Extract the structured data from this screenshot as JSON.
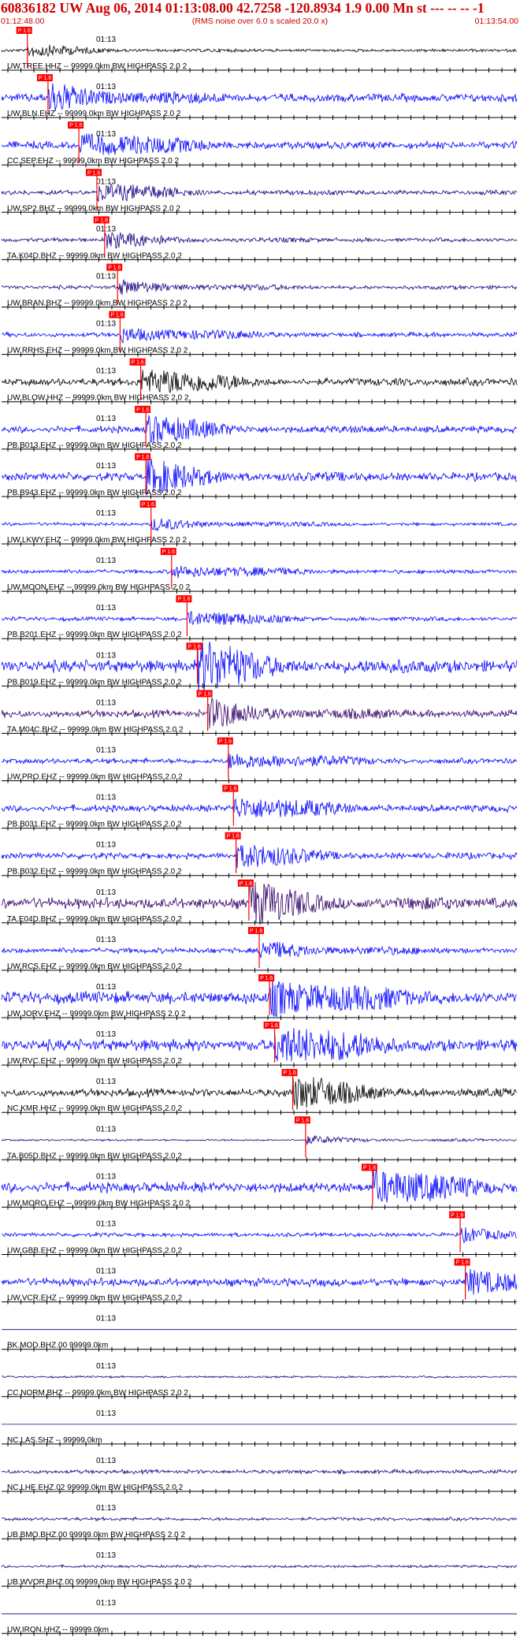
{
  "header": {
    "title": "60836182 UW Aug 06, 2014 01:13:08.00   42.7258 -120.8934  1.9 0.00 Mn st --- -- --   -1",
    "start_time": "01:12:48.00",
    "rms_note": "(RMS noise over 6.0 s scaled 20.0 x)",
    "end_time": "01:13:54.00"
  },
  "colors": {
    "header_text": "#cc0000",
    "pick_line": "#ff0000",
    "pick_box": "#ff0000",
    "axis": "#000000",
    "trace_blue": "#0000ff",
    "trace_indigo": "#1a0080",
    "trace_dark": "#330066",
    "trace_black": "#000000",
    "label_text": "#000000"
  },
  "minute_label": "01:13",
  "pick_label": "P 1.6",
  "channels": [
    {
      "label": "UW.TREE.HHZ -- 99999.0km BW  HIGHPASS  2.0  2",
      "color": "#000000",
      "level": 0.22,
      "pick": 0.05
    },
    {
      "label": "UW.BLN.EHZ -- 99999.0km BW  HIGHPASS  2.0  2",
      "color": "#0000ff",
      "level": 0.6,
      "pick": 0.09
    },
    {
      "label": "CC.SEP.EHZ -- 99999.0km BW  HIGHPASS  2.0  2",
      "color": "#0000ff",
      "level": 0.55,
      "pick": 0.15
    },
    {
      "label": "UW.SP2.BHZ -- 99999.0km BW  HIGHPASS  2.0  2",
      "color": "#1a0080",
      "level": 0.35,
      "pick": 0.185
    },
    {
      "label": "TA.K04D.BHZ -- 99999.0km BW  HIGHPASS  2.0  2",
      "color": "#1a0080",
      "level": 0.3,
      "pick": 0.2
    },
    {
      "label": "UW.BRAN.BHZ -- 99999.0km BW  HIGHPASS  2.0  2",
      "color": "#1a0080",
      "level": 0.3,
      "pick": 0.225
    },
    {
      "label": "UW.RRHS.EHZ -- 99999.0km BW  HIGHPASS  2.0  2",
      "color": "#0000ff",
      "level": 0.35,
      "pick": 0.23
    },
    {
      "label": "UW.BLOW.HHZ -- 99999.0km BW  HIGHPASS  2.0  2",
      "color": "#000000",
      "level": 0.55,
      "pick": 0.27
    },
    {
      "label": "PB.B013.EHZ -- 99999.0km BW  HIGHPASS  2.0  2",
      "color": "#0000ff",
      "level": 0.5,
      "pick": 0.28
    },
    {
      "label": "PB.B943.EHZ -- 99999.0km BW  HIGHPASS  2.0  2",
      "color": "#0000ff",
      "level": 0.6,
      "pick": 0.28
    },
    {
      "label": "UW.LKWY.EHZ -- 99999.0km BW  HIGHPASS  2.0  2",
      "color": "#0000ff",
      "level": 0.25,
      "pick": 0.29
    },
    {
      "label": "UW.MOON.EHZ -- 99999.0km BW  HIGHPASS  2.0  2",
      "color": "#0000ff",
      "level": 0.3,
      "pick": 0.33
    },
    {
      "label": "PB.B201.EHZ -- 99999.0km BW  HIGHPASS  2.0  2",
      "color": "#0000ff",
      "level": 0.3,
      "pick": 0.36
    },
    {
      "label": "PB.B019.EHZ -- 99999.0km BW  HIGHPASS  2.0  2",
      "color": "#0000ff",
      "level": 0.9,
      "pick": 0.38
    },
    {
      "label": "TA.M04C.BHZ -- 99999.0km BW  HIGHPASS  2.0  2",
      "color": "#330066",
      "level": 0.55,
      "pick": 0.4
    },
    {
      "label": "UW.PRO.EHZ -- 99999.0km BW  HIGHPASS  2.0  2",
      "color": "#0000ff",
      "level": 0.4,
      "pick": 0.44
    },
    {
      "label": "PB.B031.EHZ -- 99999.0km BW  HIGHPASS  2.0  2",
      "color": "#0000ff",
      "level": 0.5,
      "pick": 0.45
    },
    {
      "label": "PB.B032.EHZ -- 99999.0km BW  HIGHPASS  2.0  2",
      "color": "#0000ff",
      "level": 0.45,
      "pick": 0.455
    },
    {
      "label": "TA.E04D.BHZ -- 99999.0km BW  HIGHPASS  2.0  2",
      "color": "#330066",
      "level": 0.8,
      "pick": 0.48
    },
    {
      "label": "UW.RCS.EHZ -- 99999.0km BW  HIGHPASS  2.0  2",
      "color": "#0000ff",
      "level": 0.4,
      "pick": 0.5
    },
    {
      "label": "UW.JORV.EHZ -- 99999.0km BW  HIGHPASS  2.0  2",
      "color": "#0000ff",
      "level": 0.9,
      "pick": 0.52
    },
    {
      "label": "UW.RVC.EHZ -- 99999.0km BW  HIGHPASS  2.0  2",
      "color": "#0000ff",
      "level": 0.85,
      "pick": 0.53
    },
    {
      "label": "NC.KMR.HHZ -- 99999.0km BW  HIGHPASS  2.0  2",
      "color": "#000000",
      "level": 0.6,
      "pick": 0.565
    },
    {
      "label": "TA.B05D.BHZ -- 99999.0km BW  HIGHPASS  2.0  2",
      "color": "#1a0080",
      "level": 0.15,
      "pick": 0.59
    },
    {
      "label": "UW.MORO.EHZ -- 99999.0km BW  HIGHPASS  2.0  2",
      "color": "#0000ff",
      "level": 0.75,
      "pick": 0.72
    },
    {
      "label": "UW.GBB.EHZ -- 99999.0km BW  HIGHPASS  2.0  2",
      "color": "#0000ff",
      "level": 0.3,
      "pick": 0.89
    },
    {
      "label": "UW.VCR.EHZ -- 99999.0km BW  HIGHPASS  2.0  2",
      "color": "#0000ff",
      "level": 0.6,
      "pick": 0.9
    },
    {
      "label": "BK.MOD.BHZ.00 99999.0km",
      "color": "#1a0080",
      "level": 0.0,
      "pick": null
    },
    {
      "label": "CC.NORM.BHZ -- 99999.0km BW  HIGHPASS  2.0  2",
      "color": "#1a0080",
      "level": 0.15,
      "pick": null
    },
    {
      "label": "NC.LAS.SHZ -- 99999.0km",
      "color": "#1a0080",
      "level": 0.0,
      "pick": null
    },
    {
      "label": "NC.LHE.EHZ.02 99999.0km BW  HIGHPASS  2.0  2",
      "color": "#1a0080",
      "level": 0.3,
      "pick": null
    },
    {
      "label": "UB.BMO.BHZ.00 99999.0km BW  HIGHPASS  2.0  2",
      "color": "#1a0080",
      "level": 0.25,
      "pick": null
    },
    {
      "label": "UB.WVOR.BHZ.00 99999.0km BW  HIGHPASS  2.0  2",
      "color": "#1a0080",
      "level": 0.2,
      "pick": null
    },
    {
      "label": "UW.IRON.HHZ -- 99999.0km",
      "color": "#1a0080",
      "level": 0.0,
      "pick": null
    }
  ]
}
